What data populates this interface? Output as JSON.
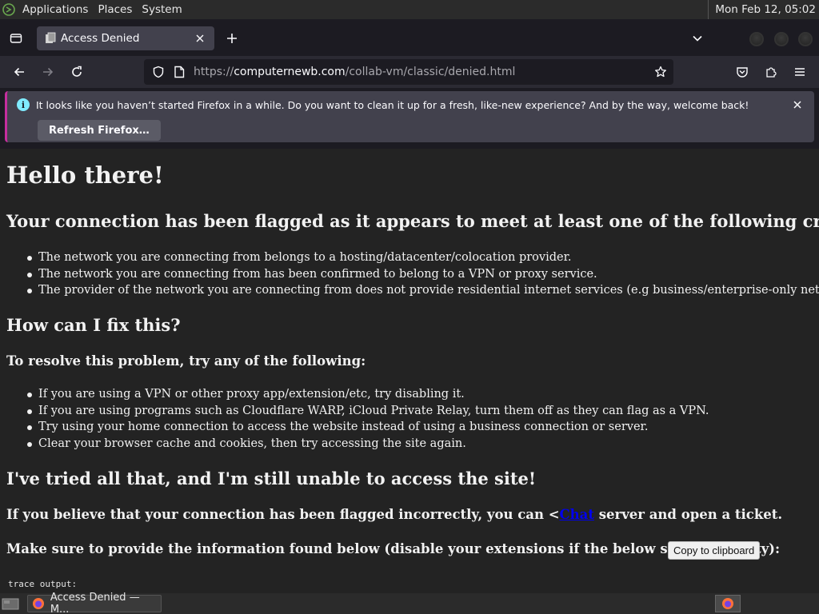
{
  "panel": {
    "menus": [
      "Applications",
      "Places",
      "System"
    ],
    "clock": "Mon Feb 12, 05:02"
  },
  "browser": {
    "tab_title": "Access Denied",
    "url_prefix": "https://",
    "url_host": "computernewb.com",
    "url_path": "/collab-vm/classic/denied.html",
    "notification": {
      "message": "It looks like you haven’t started Firefox in a while. Do you want to clean it up for a fresh, like-new experience? And by the way, welcome back!",
      "button": "Refresh Firefox…"
    }
  },
  "page": {
    "h1": "Hello there!",
    "h2_flagged": "Your connection has been flagged as it appears to meet at least one of the following criteria:",
    "criteria": [
      "The network you are connecting from belongs to a hosting/datacenter/colocation provider.",
      "The network you are connecting from has been confirmed to belong to a VPN or proxy service.",
      "The provider of the network you are connecting from does not provide residential internet services (e.g business/enterprise-only networks)."
    ],
    "h2_fix": "How can I fix this?",
    "h3_resolve": "To resolve this problem, try any of the following:",
    "fixes": [
      "If you are using a VPN or other proxy app/extension/etc, try disabling it.",
      "If you are using programs such as Cloudflare WARP, iCloud Private Relay, turn them off as they can flag as a VPN.",
      "Try using your home connection to access the website instead of using a business connection or server.",
      "Clear your browser cache and cookies, then try accessing the site again."
    ],
    "h2_tried": "I've tried all that, and I'm still unable to access the site!",
    "ticket_before": "If you believe that your connection has been flagged incorrectly, you can <",
    "ticket_link": "Chat",
    "ticket_after": " server and open a ticket.",
    "provide_info": "Make sure to provide the information found below (disable your extensions if the below space is empty):",
    "copy_button": "Copy to clipboard",
    "trace_label": "trace output:"
  },
  "taskbar": {
    "task_label": "Access Denied — M..."
  }
}
